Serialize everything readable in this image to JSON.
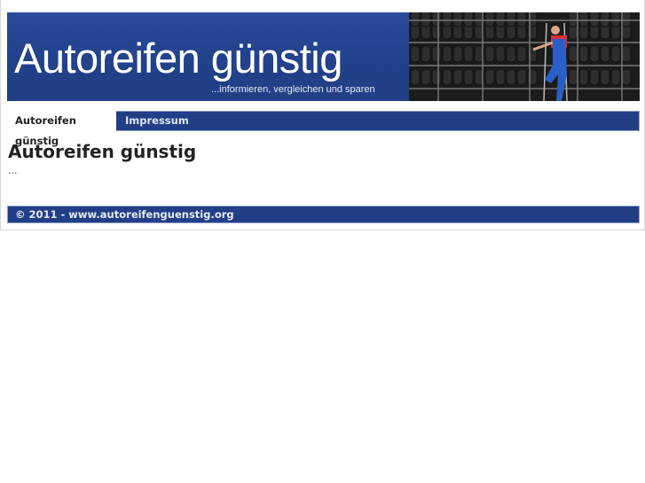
{
  "header": {
    "title": "Autoreifen günstig",
    "subtitle": "...informieren, vergleichen und sparen"
  },
  "nav": {
    "items": [
      {
        "label": "Autoreifen günstig",
        "active": true
      },
      {
        "label": "Impressum",
        "active": false
      }
    ]
  },
  "main": {
    "heading": "Autoreifen günstig",
    "body": "..."
  },
  "footer": {
    "text": "© 2011 - www.autoreifenguenstig.org"
  },
  "colors": {
    "brand": "#223e87"
  }
}
